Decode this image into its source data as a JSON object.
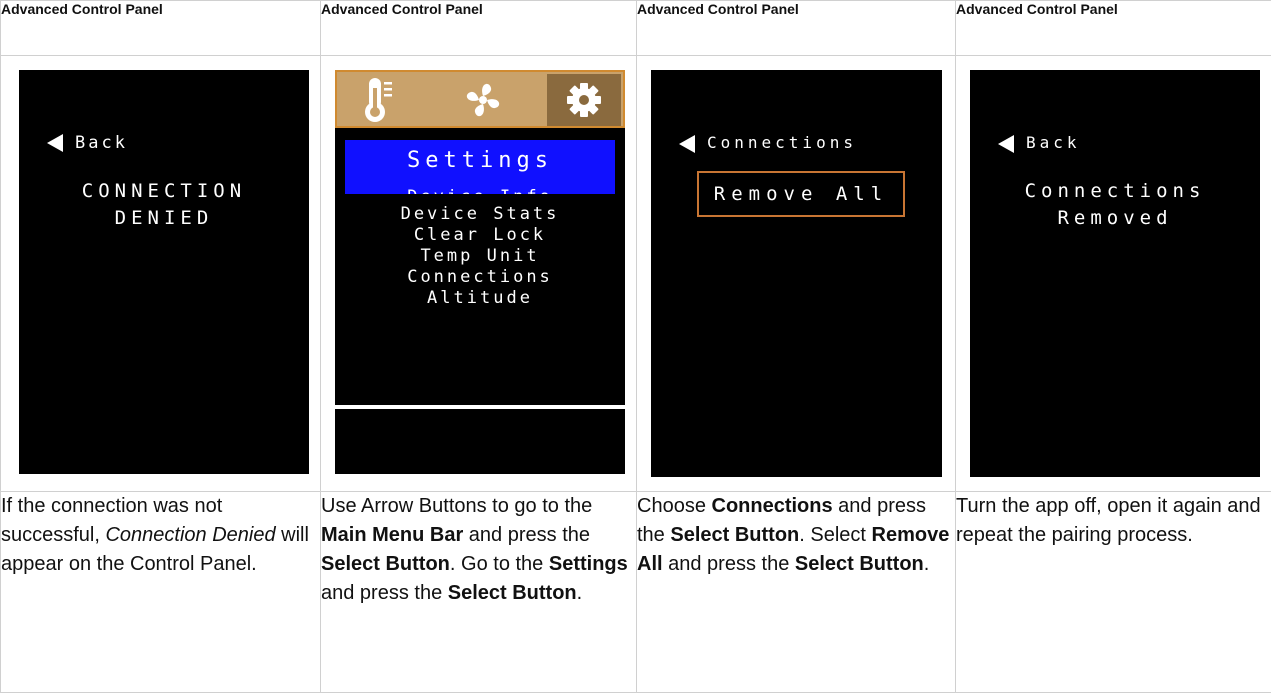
{
  "columns": [
    {
      "header": "Advanced Control Panel",
      "screen": {
        "back_label": "Back",
        "message_lines": [
          "CONNECTION",
          "DENIED"
        ]
      }
    },
    {
      "header": "Advanced Control Panel",
      "screen": {
        "tab_icons": [
          "thermometer-icon",
          "fan-icon",
          "gear-icon"
        ],
        "selected_tab": "gear-icon",
        "title": "Settings",
        "menu_items_partial": "Device Info",
        "menu_items": [
          "Device Stats",
          "Clear Lock",
          "Temp Unit",
          "Connections",
          "Altitude"
        ]
      }
    },
    {
      "header": "Advanced Control Panel",
      "screen": {
        "back_label": "Connections",
        "button_label": "Remove All"
      }
    },
    {
      "header": "Advanced Control Panel",
      "screen": {
        "back_label": "Back",
        "message_lines": [
          "Connections",
          "Removed"
        ]
      }
    }
  ],
  "descriptions": {
    "col1": {
      "t1": "If the connection was not successful, ",
      "t2": "Connection Denied",
      "t3": " will appear on the Control Panel."
    },
    "col2": {
      "t1": "Use Arrow Buttons to go to the ",
      "b1": "Main Menu Bar",
      "t2": " and press the ",
      "b2": "Select Button",
      "t3": ". Go to the ",
      "b3": "Settings",
      "t4": " and press the ",
      "b4": "Select Button",
      "t5": "."
    },
    "col3": {
      "t1": "Choose ",
      "b1": "Connections",
      "t2": " and press the ",
      "b2": "Select Button",
      "t3": ". Select ",
      "b3": "Remove All",
      "t4": " and press the ",
      "b4": "Select Button",
      "t5": "."
    },
    "col4": {
      "t1": "Turn the app off, open it again and repeat the pairing process."
    }
  },
  "colors": {
    "panel_bg": "#000000",
    "tab_bar": "#c9a26b",
    "tab_selected": "#8a6a3e",
    "title_bar": "#1010ff",
    "button_border": "#c87533",
    "grid": "#d0d0d0"
  }
}
